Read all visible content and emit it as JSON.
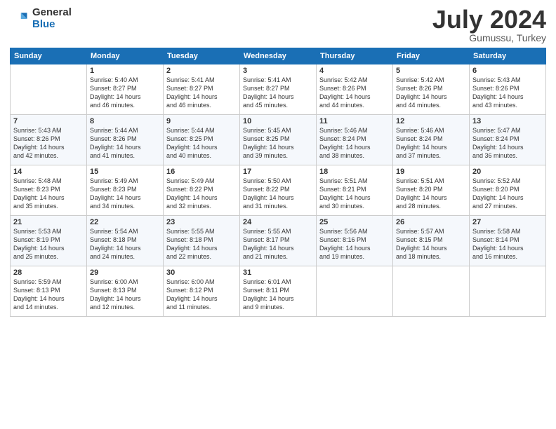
{
  "logo": {
    "general": "General",
    "blue": "Blue"
  },
  "title": {
    "month_year": "July 2024",
    "location": "Gumussu, Turkey"
  },
  "headers": [
    "Sunday",
    "Monday",
    "Tuesday",
    "Wednesday",
    "Thursday",
    "Friday",
    "Saturday"
  ],
  "weeks": [
    [
      {
        "day": "",
        "sunrise": "",
        "sunset": "",
        "daylight": ""
      },
      {
        "day": "1",
        "sunrise": "Sunrise: 5:40 AM",
        "sunset": "Sunset: 8:27 PM",
        "daylight": "Daylight: 14 hours and 46 minutes."
      },
      {
        "day": "2",
        "sunrise": "Sunrise: 5:41 AM",
        "sunset": "Sunset: 8:27 PM",
        "daylight": "Daylight: 14 hours and 46 minutes."
      },
      {
        "day": "3",
        "sunrise": "Sunrise: 5:41 AM",
        "sunset": "Sunset: 8:27 PM",
        "daylight": "Daylight: 14 hours and 45 minutes."
      },
      {
        "day": "4",
        "sunrise": "Sunrise: 5:42 AM",
        "sunset": "Sunset: 8:26 PM",
        "daylight": "Daylight: 14 hours and 44 minutes."
      },
      {
        "day": "5",
        "sunrise": "Sunrise: 5:42 AM",
        "sunset": "Sunset: 8:26 PM",
        "daylight": "Daylight: 14 hours and 44 minutes."
      },
      {
        "day": "6",
        "sunrise": "Sunrise: 5:43 AM",
        "sunset": "Sunset: 8:26 PM",
        "daylight": "Daylight: 14 hours and 43 minutes."
      }
    ],
    [
      {
        "day": "7",
        "sunrise": "Sunrise: 5:43 AM",
        "sunset": "Sunset: 8:26 PM",
        "daylight": "Daylight: 14 hours and 42 minutes."
      },
      {
        "day": "8",
        "sunrise": "Sunrise: 5:44 AM",
        "sunset": "Sunset: 8:26 PM",
        "daylight": "Daylight: 14 hours and 41 minutes."
      },
      {
        "day": "9",
        "sunrise": "Sunrise: 5:44 AM",
        "sunset": "Sunset: 8:25 PM",
        "daylight": "Daylight: 14 hours and 40 minutes."
      },
      {
        "day": "10",
        "sunrise": "Sunrise: 5:45 AM",
        "sunset": "Sunset: 8:25 PM",
        "daylight": "Daylight: 14 hours and 39 minutes."
      },
      {
        "day": "11",
        "sunrise": "Sunrise: 5:46 AM",
        "sunset": "Sunset: 8:24 PM",
        "daylight": "Daylight: 14 hours and 38 minutes."
      },
      {
        "day": "12",
        "sunrise": "Sunrise: 5:46 AM",
        "sunset": "Sunset: 8:24 PM",
        "daylight": "Daylight: 14 hours and 37 minutes."
      },
      {
        "day": "13",
        "sunrise": "Sunrise: 5:47 AM",
        "sunset": "Sunset: 8:24 PM",
        "daylight": "Daylight: 14 hours and 36 minutes."
      }
    ],
    [
      {
        "day": "14",
        "sunrise": "Sunrise: 5:48 AM",
        "sunset": "Sunset: 8:23 PM",
        "daylight": "Daylight: 14 hours and 35 minutes."
      },
      {
        "day": "15",
        "sunrise": "Sunrise: 5:49 AM",
        "sunset": "Sunset: 8:23 PM",
        "daylight": "Daylight: 14 hours and 34 minutes."
      },
      {
        "day": "16",
        "sunrise": "Sunrise: 5:49 AM",
        "sunset": "Sunset: 8:22 PM",
        "daylight": "Daylight: 14 hours and 32 minutes."
      },
      {
        "day": "17",
        "sunrise": "Sunrise: 5:50 AM",
        "sunset": "Sunset: 8:22 PM",
        "daylight": "Daylight: 14 hours and 31 minutes."
      },
      {
        "day": "18",
        "sunrise": "Sunrise: 5:51 AM",
        "sunset": "Sunset: 8:21 PM",
        "daylight": "Daylight: 14 hours and 30 minutes."
      },
      {
        "day": "19",
        "sunrise": "Sunrise: 5:51 AM",
        "sunset": "Sunset: 8:20 PM",
        "daylight": "Daylight: 14 hours and 28 minutes."
      },
      {
        "day": "20",
        "sunrise": "Sunrise: 5:52 AM",
        "sunset": "Sunset: 8:20 PM",
        "daylight": "Daylight: 14 hours and 27 minutes."
      }
    ],
    [
      {
        "day": "21",
        "sunrise": "Sunrise: 5:53 AM",
        "sunset": "Sunset: 8:19 PM",
        "daylight": "Daylight: 14 hours and 25 minutes."
      },
      {
        "day": "22",
        "sunrise": "Sunrise: 5:54 AM",
        "sunset": "Sunset: 8:18 PM",
        "daylight": "Daylight: 14 hours and 24 minutes."
      },
      {
        "day": "23",
        "sunrise": "Sunrise: 5:55 AM",
        "sunset": "Sunset: 8:18 PM",
        "daylight": "Daylight: 14 hours and 22 minutes."
      },
      {
        "day": "24",
        "sunrise": "Sunrise: 5:55 AM",
        "sunset": "Sunset: 8:17 PM",
        "daylight": "Daylight: 14 hours and 21 minutes."
      },
      {
        "day": "25",
        "sunrise": "Sunrise: 5:56 AM",
        "sunset": "Sunset: 8:16 PM",
        "daylight": "Daylight: 14 hours and 19 minutes."
      },
      {
        "day": "26",
        "sunrise": "Sunrise: 5:57 AM",
        "sunset": "Sunset: 8:15 PM",
        "daylight": "Daylight: 14 hours and 18 minutes."
      },
      {
        "day": "27",
        "sunrise": "Sunrise: 5:58 AM",
        "sunset": "Sunset: 8:14 PM",
        "daylight": "Daylight: 14 hours and 16 minutes."
      }
    ],
    [
      {
        "day": "28",
        "sunrise": "Sunrise: 5:59 AM",
        "sunset": "Sunset: 8:13 PM",
        "daylight": "Daylight: 14 hours and 14 minutes."
      },
      {
        "day": "29",
        "sunrise": "Sunrise: 6:00 AM",
        "sunset": "Sunset: 8:13 PM",
        "daylight": "Daylight: 14 hours and 12 minutes."
      },
      {
        "day": "30",
        "sunrise": "Sunrise: 6:00 AM",
        "sunset": "Sunset: 8:12 PM",
        "daylight": "Daylight: 14 hours and 11 minutes."
      },
      {
        "day": "31",
        "sunrise": "Sunrise: 6:01 AM",
        "sunset": "Sunset: 8:11 PM",
        "daylight": "Daylight: 14 hours and 9 minutes."
      },
      {
        "day": "",
        "sunrise": "",
        "sunset": "",
        "daylight": ""
      },
      {
        "day": "",
        "sunrise": "",
        "sunset": "",
        "daylight": ""
      },
      {
        "day": "",
        "sunrise": "",
        "sunset": "",
        "daylight": ""
      }
    ]
  ]
}
